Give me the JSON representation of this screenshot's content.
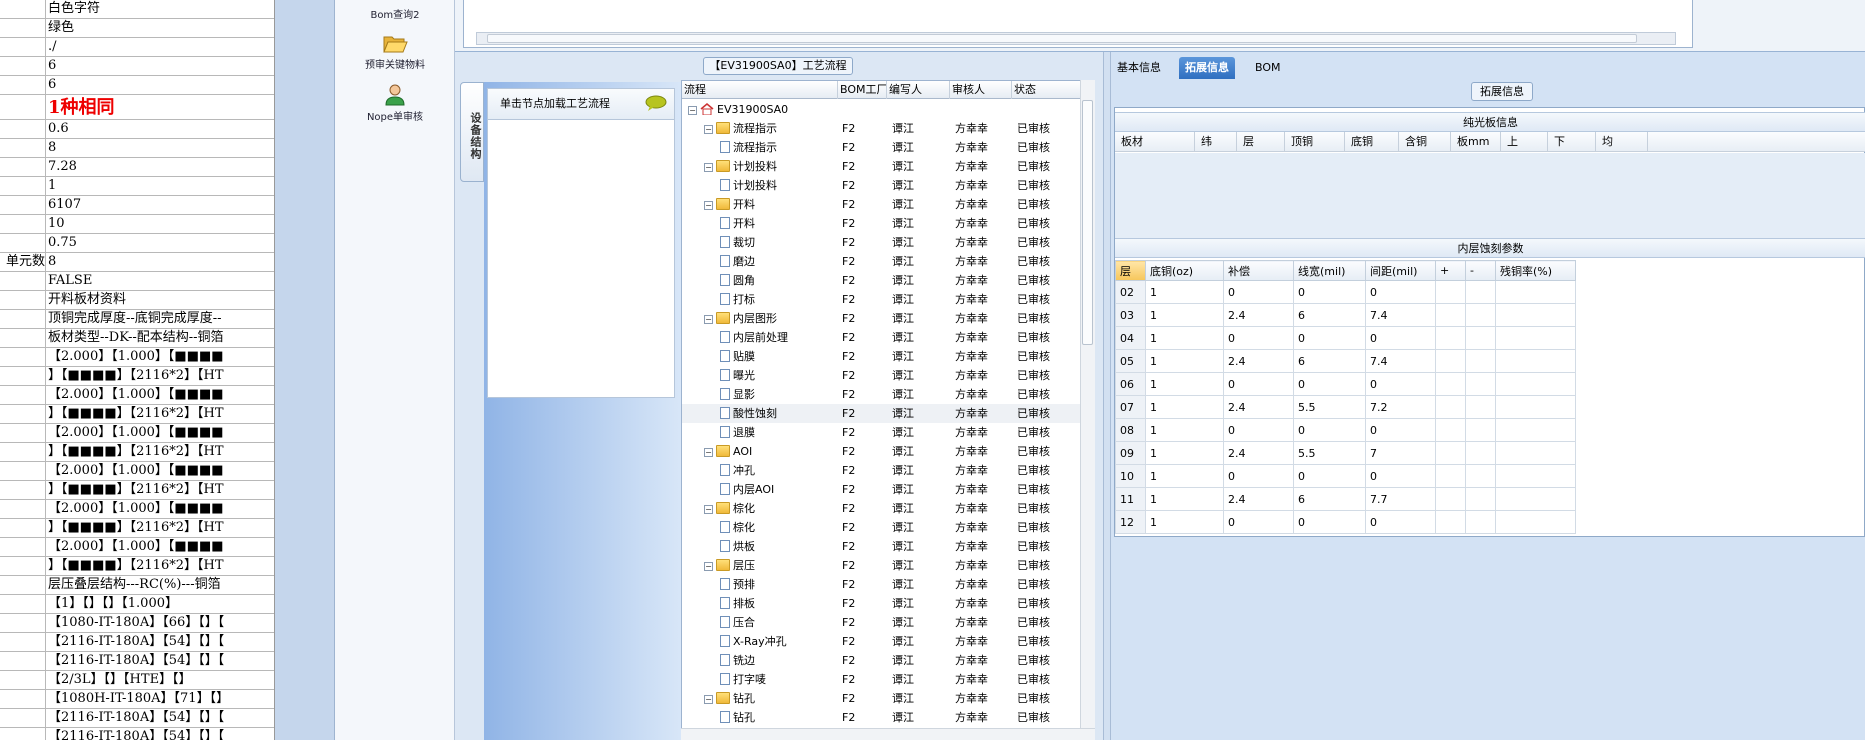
{
  "sheet": {
    "rows": [
      {
        "a": "",
        "b": "白色字符"
      },
      {
        "a": "",
        "b": "绿色"
      },
      {
        "a": "",
        "b": "./"
      },
      {
        "a": "",
        "b": "6"
      },
      {
        "a": "",
        "b": "6"
      },
      {
        "a": "",
        "b": "1种相同"
      },
      {
        "a": "",
        "b": "0.6"
      },
      {
        "a": "",
        "b": "8"
      },
      {
        "a": "",
        "b": "7.28"
      },
      {
        "a": "",
        "b": "1"
      },
      {
        "a": "",
        "b": "6107"
      },
      {
        "a": "",
        "b": "10"
      },
      {
        "a": "",
        "b": "0.75"
      },
      {
        "a": "单元数",
        "b": "8"
      },
      {
        "a": "",
        "b": "FALSE"
      },
      {
        "a": "",
        "b": "开料板材资料"
      },
      {
        "a": "",
        "b": "顶铜完成厚度--底铜完成厚度--"
      },
      {
        "a": "",
        "b": "板材类型--DK--配本结构--铜箔"
      },
      {
        "a": "",
        "b": "【2.000】【1.000】【■■■■"
      },
      {
        "a": "",
        "b": "】【■■■■】【2116*2】【HT"
      },
      {
        "a": "",
        "b": "【2.000】【1.000】【■■■■"
      },
      {
        "a": "",
        "b": "】【■■■■】【2116*2】【HT"
      },
      {
        "a": "",
        "b": "【2.000】【1.000】【■■■■"
      },
      {
        "a": "",
        "b": "】【■■■■】【2116*2】【HT"
      },
      {
        "a": "",
        "b": "【2.000】【1.000】【■■■■"
      },
      {
        "a": "",
        "b": "】【■■■■】【2116*2】【HT"
      },
      {
        "a": "",
        "b": "【2.000】【1.000】【■■■■"
      },
      {
        "a": "",
        "b": "】【■■■■】【2116*2】【HT"
      },
      {
        "a": "",
        "b": "【2.000】【1.000】【■■■■"
      },
      {
        "a": "",
        "b": "】【■■■■】【2116*2】【HT"
      },
      {
        "a": "",
        "b": "层压叠层结构---RC(%)---铜箔"
      },
      {
        "a": "",
        "b": "【1】【】【】【1.000】"
      },
      {
        "a": "",
        "b": "【1080-IT-180A】【66】【】【"
      },
      {
        "a": "",
        "b": "【2116-IT-180A】【54】【】【"
      },
      {
        "a": "",
        "b": "【2116-IT-180A】【54】【】【"
      },
      {
        "a": "",
        "b": "【2/3L】【】【HTE】【】"
      },
      {
        "a": "",
        "b": "【1080H-IT-180A】【71】【】"
      },
      {
        "a": "",
        "b": "【2116-IT-180A】【54】【】【"
      },
      {
        "a": "",
        "b": "【2116-IT-180A】【54】【】【"
      }
    ]
  },
  "toolbar": {
    "bom2": "Bom查询2",
    "prereview": "预审关键物料",
    "nope": "Nope单审核"
  },
  "process": {
    "title": "【EV31900SA0】工艺流程",
    "vtab": "设备结构",
    "hint": "单击节点加载工艺流程",
    "columns": [
      "流程",
      "BOM工厂",
      "编写人",
      "审核人",
      "状态"
    ],
    "rows": [
      {
        "level": 0,
        "type": "home",
        "name": "EV31900SA0",
        "plant": "",
        "writer": "",
        "reviewer": "",
        "status": ""
      },
      {
        "level": 1,
        "type": "folder",
        "name": "流程指示",
        "plant": "F2",
        "writer": "谭江",
        "reviewer": "方幸幸",
        "status": "已审核"
      },
      {
        "level": 2,
        "type": "doc",
        "name": "流程指示",
        "plant": "F2",
        "writer": "谭江",
        "reviewer": "方幸幸",
        "status": "已审核"
      },
      {
        "level": 1,
        "type": "folder",
        "name": "计划投料",
        "plant": "F2",
        "writer": "谭江",
        "reviewer": "方幸幸",
        "status": "已审核"
      },
      {
        "level": 2,
        "type": "doc",
        "name": "计划投料",
        "plant": "F2",
        "writer": "谭江",
        "reviewer": "方幸幸",
        "status": "已审核"
      },
      {
        "level": 1,
        "type": "folder",
        "name": "开料",
        "plant": "F2",
        "writer": "谭江",
        "reviewer": "方幸幸",
        "status": "已审核"
      },
      {
        "level": 2,
        "type": "doc",
        "name": "开料",
        "plant": "F2",
        "writer": "谭江",
        "reviewer": "方幸幸",
        "status": "已审核"
      },
      {
        "level": 2,
        "type": "doc",
        "name": "裁切",
        "plant": "F2",
        "writer": "谭江",
        "reviewer": "方幸幸",
        "status": "已审核"
      },
      {
        "level": 2,
        "type": "doc",
        "name": "磨边",
        "plant": "F2",
        "writer": "谭江",
        "reviewer": "方幸幸",
        "status": "已审核"
      },
      {
        "level": 2,
        "type": "doc",
        "name": "圆角",
        "plant": "F2",
        "writer": "谭江",
        "reviewer": "方幸幸",
        "status": "已审核"
      },
      {
        "level": 2,
        "type": "doc",
        "name": "打标",
        "plant": "F2",
        "writer": "谭江",
        "reviewer": "方幸幸",
        "status": "已审核"
      },
      {
        "level": 1,
        "type": "folder",
        "name": "内层图形",
        "plant": "F2",
        "writer": "谭江",
        "reviewer": "方幸幸",
        "status": "已审核"
      },
      {
        "level": 2,
        "type": "doc",
        "name": "内层前处理",
        "plant": "F2",
        "writer": "谭江",
        "reviewer": "方幸幸",
        "status": "已审核"
      },
      {
        "level": 2,
        "type": "doc",
        "name": "贴膜",
        "plant": "F2",
        "writer": "谭江",
        "reviewer": "方幸幸",
        "status": "已审核"
      },
      {
        "level": 2,
        "type": "doc",
        "name": "曝光",
        "plant": "F2",
        "writer": "谭江",
        "reviewer": "方幸幸",
        "status": "已审核"
      },
      {
        "level": 2,
        "type": "doc",
        "name": "显影",
        "plant": "F2",
        "writer": "谭江",
        "reviewer": "方幸幸",
        "status": "已审核"
      },
      {
        "level": 2,
        "type": "doc",
        "name": "酸性蚀刻",
        "plant": "F2",
        "writer": "谭江",
        "reviewer": "方幸幸",
        "status": "已审核",
        "selected": true
      },
      {
        "level": 2,
        "type": "doc",
        "name": "退膜",
        "plant": "F2",
        "writer": "谭江",
        "reviewer": "方幸幸",
        "status": "已审核"
      },
      {
        "level": 1,
        "type": "folder",
        "name": "AOI",
        "plant": "F2",
        "writer": "谭江",
        "reviewer": "方幸幸",
        "status": "已审核"
      },
      {
        "level": 2,
        "type": "doc",
        "name": "冲孔",
        "plant": "F2",
        "writer": "谭江",
        "reviewer": "方幸幸",
        "status": "已审核"
      },
      {
        "level": 2,
        "type": "doc",
        "name": "内层AOI",
        "plant": "F2",
        "writer": "谭江",
        "reviewer": "方幸幸",
        "status": "已审核"
      },
      {
        "level": 1,
        "type": "folder",
        "name": "棕化",
        "plant": "F2",
        "writer": "谭江",
        "reviewer": "方幸幸",
        "status": "已审核"
      },
      {
        "level": 2,
        "type": "doc",
        "name": "棕化",
        "plant": "F2",
        "writer": "谭江",
        "reviewer": "方幸幸",
        "status": "已审核"
      },
      {
        "level": 2,
        "type": "doc",
        "name": "烘板",
        "plant": "F2",
        "writer": "谭江",
        "reviewer": "方幸幸",
        "status": "已审核"
      },
      {
        "level": 1,
        "type": "folder",
        "name": "层压",
        "plant": "F2",
        "writer": "谭江",
        "reviewer": "方幸幸",
        "status": "已审核"
      },
      {
        "level": 2,
        "type": "doc",
        "name": "预排",
        "plant": "F2",
        "writer": "谭江",
        "reviewer": "方幸幸",
        "status": "已审核"
      },
      {
        "level": 2,
        "type": "doc",
        "name": "排板",
        "plant": "F2",
        "writer": "谭江",
        "reviewer": "方幸幸",
        "status": "已审核"
      },
      {
        "level": 2,
        "type": "doc",
        "name": "压合",
        "plant": "F2",
        "writer": "谭江",
        "reviewer": "方幸幸",
        "status": "已审核"
      },
      {
        "level": 2,
        "type": "doc",
        "name": "X-Ray冲孔",
        "plant": "F2",
        "writer": "谭江",
        "reviewer": "方幸幸",
        "status": "已审核"
      },
      {
        "level": 2,
        "type": "doc",
        "name": "铣边",
        "plant": "F2",
        "writer": "谭江",
        "reviewer": "方幸幸",
        "status": "已审核"
      },
      {
        "level": 2,
        "type": "doc",
        "name": "打字唛",
        "plant": "F2",
        "writer": "谭江",
        "reviewer": "方幸幸",
        "status": "已审核"
      },
      {
        "level": 1,
        "type": "folder",
        "name": "钻孔",
        "plant": "F2",
        "writer": "谭江",
        "reviewer": "方幸幸",
        "status": "已审核"
      },
      {
        "level": 2,
        "type": "doc",
        "name": "钻孔",
        "plant": "F2",
        "writer": "谭江",
        "reviewer": "方幸幸",
        "status": "已审核"
      }
    ]
  },
  "info": {
    "tabs": [
      "基本信息",
      "拓展信息",
      "BOM"
    ],
    "active_tab": 1,
    "ext_title": "拓展信息",
    "board_section": "纯光板信息",
    "board_columns": [
      "板材",
      "纬",
      "层",
      "顶铜",
      "底铜",
      "含铜",
      "板mm",
      "上",
      "下",
      "均"
    ],
    "etch_section": "内层蚀刻参数",
    "etch_columns": [
      "层",
      "底铜(oz)",
      "补偿",
      "线宽(mil)",
      "间距(mil)",
      "+",
      "-",
      "残铜率(%)"
    ],
    "etch_rows": [
      [
        "02",
        "1",
        "0",
        "0",
        "0",
        "",
        "",
        ""
      ],
      [
        "03",
        "1",
        "2.4",
        "6",
        "7.4",
        "",
        "",
        ""
      ],
      [
        "04",
        "1",
        "0",
        "0",
        "0",
        "",
        "",
        ""
      ],
      [
        "05",
        "1",
        "2.4",
        "6",
        "7.4",
        "",
        "",
        ""
      ],
      [
        "06",
        "1",
        "0",
        "0",
        "0",
        "",
        "",
        ""
      ],
      [
        "07",
        "1",
        "2.4",
        "5.5",
        "7.2",
        "",
        "",
        ""
      ],
      [
        "08",
        "1",
        "0",
        "0",
        "0",
        "",
        "",
        ""
      ],
      [
        "09",
        "1",
        "2.4",
        "5.5",
        "7",
        "",
        "",
        ""
      ],
      [
        "10",
        "1",
        "0",
        "0",
        "0",
        "",
        "",
        ""
      ],
      [
        "11",
        "1",
        "2.4",
        "6",
        "7.7",
        "",
        "",
        ""
      ],
      [
        "12",
        "1",
        "0",
        "0",
        "0",
        "",
        "",
        ""
      ]
    ]
  },
  "colors": {
    "accent": "#2f6fc0",
    "panel": "#d3e2f4",
    "red_text": "#e00000"
  }
}
